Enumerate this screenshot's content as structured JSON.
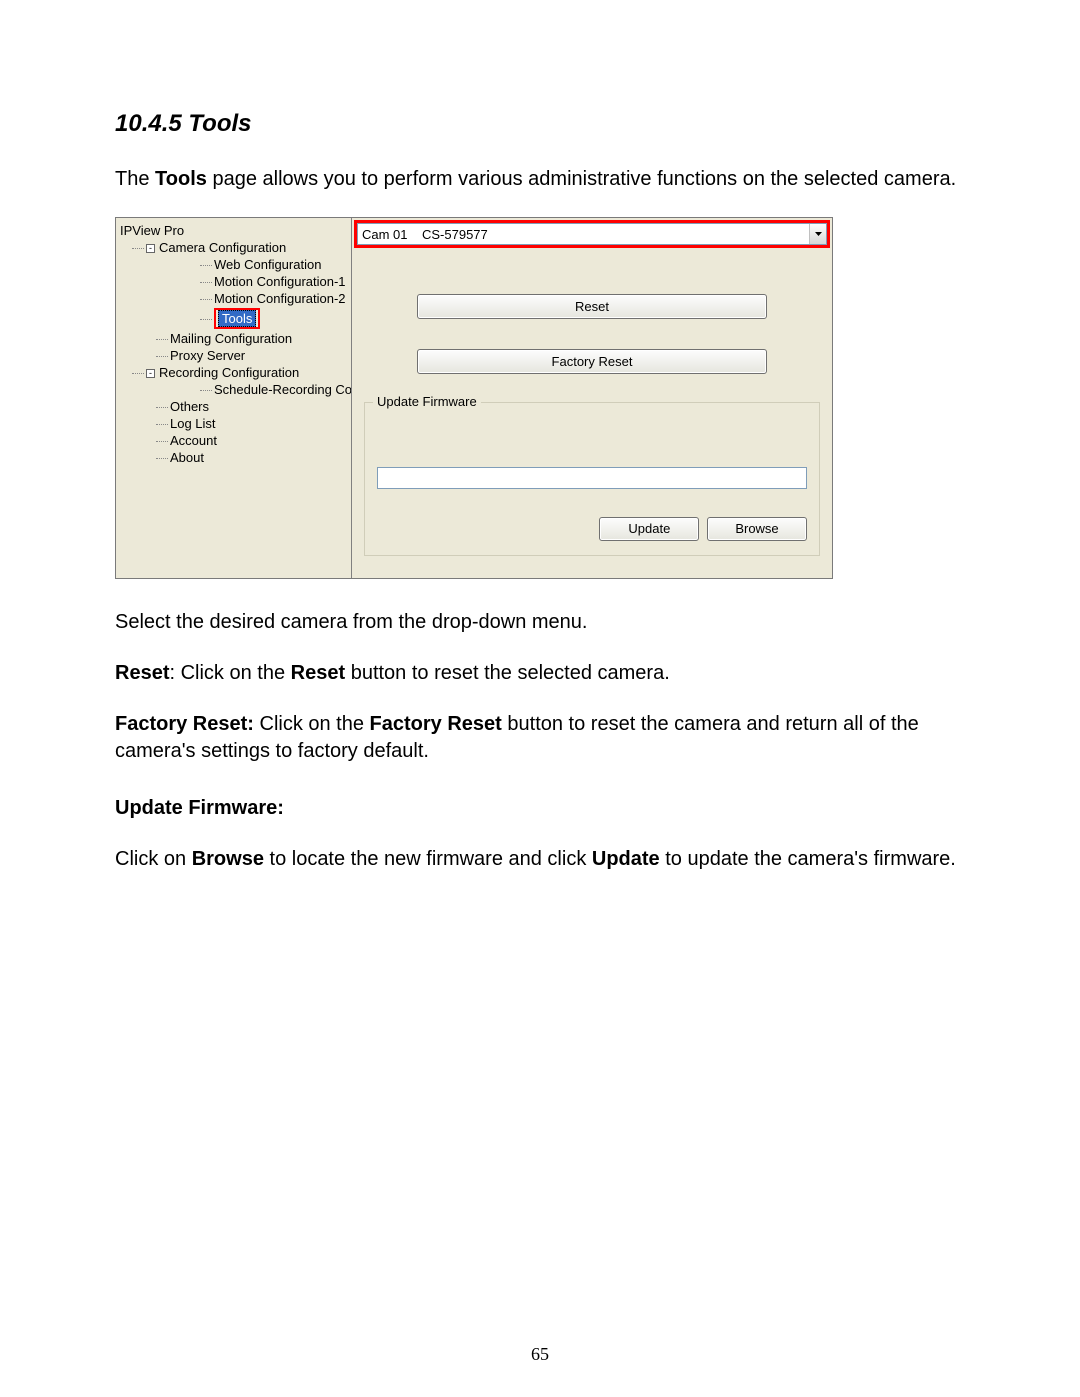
{
  "heading": "10.4.5 Tools",
  "intro_1": "The ",
  "intro_bold": "Tools",
  "intro_2": " page allows you to perform various administrative functions on the selected camera.",
  "tree": {
    "root": "IPView Pro",
    "camera_config": "Camera Configuration",
    "web_config": "Web Configuration",
    "motion1": "Motion Configuration-1",
    "motion2": "Motion Configuration-2",
    "tools": "Tools",
    "mailing": "Mailing Configuration",
    "proxy": "Proxy Server",
    "recording": "Recording Configuration",
    "schedule": "Schedule-Recording Con",
    "others": "Others",
    "loglist": "Log List",
    "account": "Account",
    "about": "About"
  },
  "dropdown": {
    "cam_label": "Cam 01",
    "cam_value": "CS-579577"
  },
  "buttons": {
    "reset": "Reset",
    "factory_reset": "Factory Reset",
    "update": "Update",
    "browse": "Browse"
  },
  "fieldset_legend": "Update Firmware",
  "body_text": {
    "t1": "Select the desired camera from the drop-down menu.",
    "reset_b": "Reset",
    "reset_t": ": Click on the ",
    "reset_b2": "Reset",
    "reset_t2": " button to reset the selected camera.",
    "fr_b": "Factory Reset:",
    "fr_t": " Click on the ",
    "fr_b2": "Factory Reset",
    "fr_t2": " button to reset the camera and return all of the camera's settings to factory default.",
    "uf_b": "Update Firmware:",
    "uf_1": "Click on ",
    "uf_b2": "Browse",
    "uf_2": " to locate the new firmware and click ",
    "uf_b3": "Update",
    "uf_3": " to update the camera's firmware."
  },
  "page_number": "65"
}
